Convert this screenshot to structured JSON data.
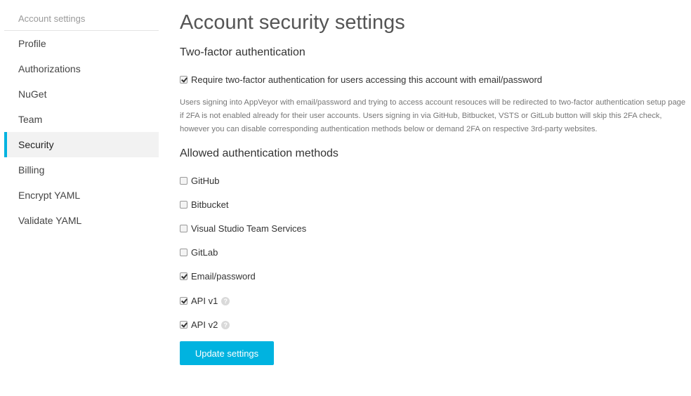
{
  "sidebar": {
    "header": "Account settings",
    "items": [
      {
        "label": "Profile"
      },
      {
        "label": "Authorizations"
      },
      {
        "label": "NuGet"
      },
      {
        "label": "Team"
      },
      {
        "label": "Security",
        "active": true
      },
      {
        "label": "Billing"
      },
      {
        "label": "Encrypt YAML"
      },
      {
        "label": "Validate YAML"
      }
    ]
  },
  "main": {
    "title": "Account security settings",
    "twofa": {
      "heading": "Two-factor authentication",
      "checkbox_label": "Require two-factor authentication for users accessing this account with email/password",
      "checked": true,
      "description": "Users signing into AppVeyor with email/password and trying to access account resouces will be redirected to two-factor authentication setup page if 2FA is not enabled already for their user accounts. Users signing in via GitHub, Bitbucket, VSTS or GitLub button will skip this 2FA check, however you can disable corresponding authentication methods below or demand 2FA on respective 3rd-party websites."
    },
    "methods": {
      "heading": "Allowed authentication methods",
      "items": [
        {
          "label": "GitHub",
          "checked": false
        },
        {
          "label": "Bitbucket",
          "checked": false
        },
        {
          "label": "Visual Studio Team Services",
          "checked": false
        },
        {
          "label": "GitLab",
          "checked": false
        },
        {
          "label": "Email/password",
          "checked": true
        },
        {
          "label": "API v1",
          "checked": true,
          "help": "?"
        },
        {
          "label": "API v2",
          "checked": true,
          "help": "?"
        }
      ]
    },
    "update_button": "Update settings"
  },
  "colors": {
    "accent": "#00b3e0",
    "active_bg": "#f2f2f2"
  }
}
